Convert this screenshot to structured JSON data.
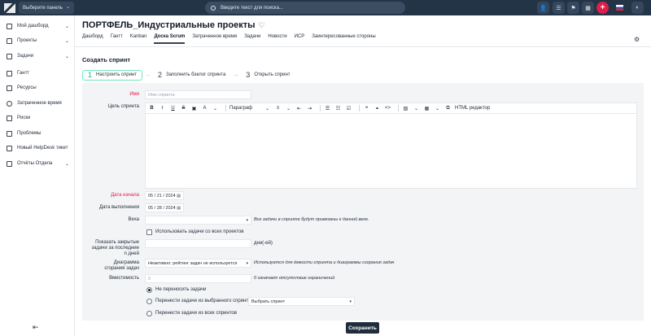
{
  "topbar": {
    "panel_select": "Выберите панель",
    "search_placeholder": "Введите текст для поиска..."
  },
  "sidebar": {
    "items": [
      {
        "label": "Мой дашборд",
        "icon": "dashboard-icon"
      },
      {
        "label": "Проекты",
        "icon": "projects-icon"
      },
      {
        "label": "Задачи",
        "icon": "tasks-icon"
      },
      {
        "label": "Гантт",
        "icon": "gantt-icon"
      },
      {
        "label": "Ресурсы",
        "icon": "resources-icon"
      },
      {
        "label": "Затраченное время",
        "icon": "clock-icon"
      },
      {
        "label": "Риски",
        "icon": "risks-icon"
      },
      {
        "label": "Проблемы",
        "icon": "problems-icon"
      },
      {
        "label": "Новый HelpDesk тикет",
        "icon": "helpdesk-icon"
      },
      {
        "label": "Отчёты Отдела",
        "icon": "reports-icon"
      }
    ]
  },
  "header": {
    "title": "ПОРТФЕЛЬ_Индустриальные проекты",
    "tabs": [
      "Дашборд",
      "Гантт",
      "Kanban",
      "Доска Scrum",
      "Затраченное время",
      "Задачи",
      "Новости",
      "ИСР",
      "Заинтересованные стороны"
    ],
    "active_tab": "Доска Scrum"
  },
  "page": {
    "section_title": "Создать спринт",
    "steps": [
      {
        "num": "1",
        "label": "Настроить спринт"
      },
      {
        "num": "2",
        "label": "Заполнить бэклог спринта"
      },
      {
        "num": "3",
        "label": "Открыть спринт"
      }
    ]
  },
  "form": {
    "name_label": "Имя",
    "name_placeholder": "Имя спринта",
    "goal_label": "Цель спринта",
    "toolbar": {
      "paragraph": "Параграф",
      "html_editor": "HTML редактор"
    },
    "start_label": "Дата начала",
    "start_value": "05 / 21 / 2024",
    "end_label": "Дата выполнения",
    "end_value": "05 / 28 / 2024",
    "milestone_label": "Веха",
    "milestone_hint": "Все задачи в спринте будут привязаны к данной вехе.",
    "use_all_projects": "Использовать задачи со всех проектов",
    "closed_label": "Показать закрытые задачи за последние n дней",
    "closed_unit": "дни(-ей)",
    "burndown_label": "Диаграмма сгорания задач",
    "burndown_value": "Неактивно: рейтинг задач не используется",
    "burndown_hint": "Используется для ёмкости спринта и диаграммы сгорания задач",
    "capacity_label": "Вместимость",
    "capacity_placeholder": "0",
    "capacity_hint": "0 означает отсутствие ограничений",
    "radio_no_transfer": "Не переносить задачи",
    "radio_from_sprint": "Перенести задачи из выбранного спринта",
    "sprint_select": "Выбрать спринт",
    "radio_all_sprints": "Перенести задачи из всех спринтов",
    "save": "Сохранить"
  }
}
